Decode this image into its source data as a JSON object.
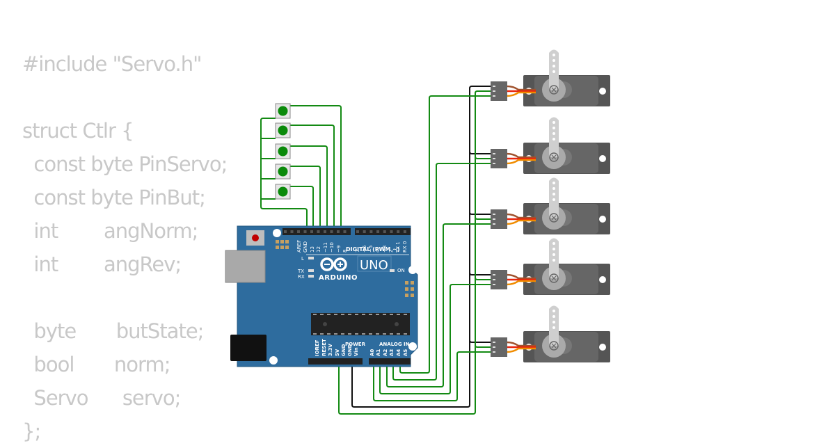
{
  "code": {
    "lines": [
      "#include \"Servo.h\"",
      "",
      "struct Ctlr {",
      "  const byte PinServo;",
      "  const byte PinBut;",
      "  int        angNorm;",
      "  int        angRev;",
      "",
      "  byte       butState;",
      "  bool       norm;",
      "  Servo      servo;",
      "};"
    ]
  },
  "board": {
    "brand": "ARDUINO",
    "model": "UNO",
    "digital_label": "DIGITAL (PWM ~)",
    "power_label": "POWER",
    "analog_label": "ANALOG IN",
    "on_label": "ON",
    "l_label": "L",
    "tx_label": "TX",
    "rx_label": "RX",
    "digital_pins": [
      "AREF",
      "GND",
      "13",
      "12",
      "~11",
      "~10",
      "~9",
      "8",
      "7",
      "~6",
      "~5",
      "4",
      "~3",
      "2",
      "TX 1",
      "RX 0"
    ],
    "power_pins": [
      "IOREF",
      "RESET",
      "3.3V",
      "5V",
      "GND",
      "GND",
      "Vin"
    ],
    "analog_pins": [
      "A0",
      "A1",
      "A2",
      "A3",
      "A4",
      "A5"
    ]
  },
  "components": {
    "buttons_count": 5,
    "servos_count": 5,
    "button_color": "#0a8a0a",
    "wire_green": "#138a13",
    "wire_black": "#111111",
    "board_color": "#2e6c9e"
  }
}
